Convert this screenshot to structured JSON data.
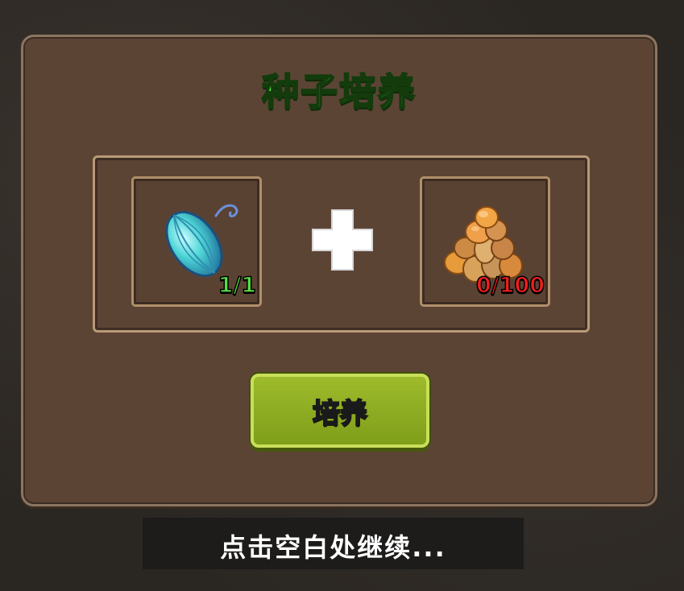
{
  "dialog": {
    "title": "种子培养",
    "ingredients": [
      {
        "item": "teal-seed",
        "icon": "seed-icon",
        "count": "1/1",
        "count_color": "#58e043"
      },
      {
        "item": "brown-nuts-pile",
        "icon": "nut-pile-icon",
        "count": "0/100",
        "count_color": "#f21d1d"
      }
    ],
    "combine_symbol": "plus-icon",
    "button_label": "培养",
    "colors": {
      "title": "#4fe03a",
      "panel": "#5c4435",
      "button": "#8fae22"
    }
  },
  "hint": "点击空白处继续..."
}
